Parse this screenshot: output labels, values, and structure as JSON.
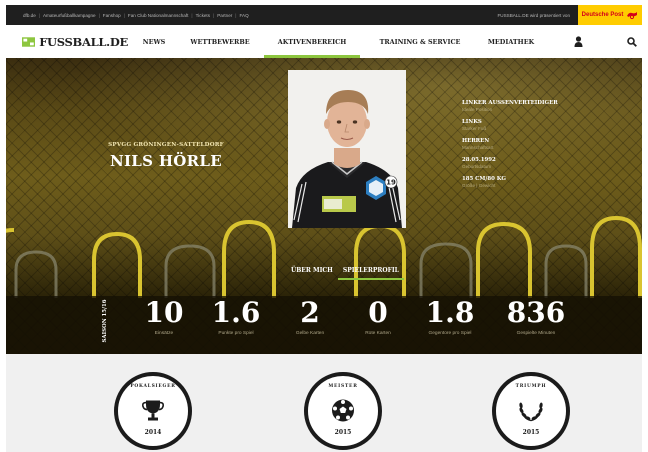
{
  "topbar": {
    "links": [
      "dfb.de",
      "Amateurfußballkampagne",
      "Fanshop",
      "Fan Club Nationalmannschaft",
      "Tickets",
      "Partner",
      "FAQ"
    ],
    "presented_text": "FUSSBALL.DE wird präsentiert von",
    "sponsor": "Deutsche Post"
  },
  "nav": {
    "logo": "FUSSBALL.DE",
    "items": [
      "NEWS",
      "WETTBEWERBE",
      "AKTIVENBEREICH",
      "TRAINING & SERVICE",
      "MEDIATHEK"
    ],
    "active": "AKTIVENBEREICH",
    "user_icon": "user-icon",
    "search_icon": "search-icon"
  },
  "player": {
    "club": "SPVGG GRÖNINGEN-SATTELDORF",
    "name": "NILS HÖRLE",
    "jersey_number": "19",
    "facts": [
      {
        "value": "LINKER AUSSENVERTEIDIGER",
        "label": "Ideale Position"
      },
      {
        "value": "LINKS",
        "label": "Starker Fuß"
      },
      {
        "value": "HERREN",
        "label": "Mannschaftsart"
      },
      {
        "value": "28.05.1992",
        "label": "Geburtsdatum"
      },
      {
        "value": "185 CM/80 KG",
        "label": "Größe | Gewicht"
      }
    ]
  },
  "tabs": [
    {
      "label": "ÜBER MICH",
      "active": false
    },
    {
      "label": "SPIELERPROFIL",
      "active": true
    }
  ],
  "season": "SAISON 15/16",
  "stats": [
    {
      "value": "10",
      "label": "Einsätze"
    },
    {
      "value": "1.6",
      "label": "Punkte pro Spiel"
    },
    {
      "value": "2",
      "label": "Gelbe Karten"
    },
    {
      "value": "0",
      "label": "Rote Karten"
    },
    {
      "value": "1.8",
      "label": "Gegentore pro Spiel"
    },
    {
      "value": "836",
      "label": "Gespielte Minuten"
    }
  ],
  "achievements": [
    {
      "title": "POKALSIEGER",
      "year": "2014",
      "icon": "trophy-icon"
    },
    {
      "title": "MEISTER",
      "year": "2015",
      "icon": "football-icon"
    },
    {
      "title": "TRIUMPH",
      "year": "2015",
      "icon": "laurel-icon"
    }
  ],
  "colors": {
    "accent": "#8dc63f",
    "sponsor_bg": "#ffcc00",
    "sponsor_text": "#d4001a",
    "topbar_bg": "#1f1f1f",
    "arch_yellow": "#d9c430"
  }
}
